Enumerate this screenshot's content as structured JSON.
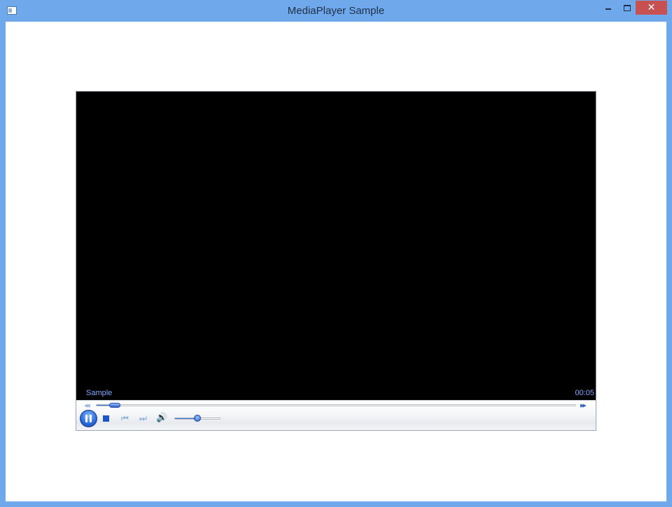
{
  "window": {
    "title": "MediaPlayer Sample",
    "close_glyph": "✕"
  },
  "player": {
    "media_title": "Sample",
    "elapsed_time": "00:05",
    "seek_progress": 0.03,
    "volume_level": 0.5,
    "colors": {
      "accent": "#2f6fe0",
      "label_text": "#7fa7ff",
      "close_button": "#c75050",
      "titlebar": "#6fa9ec"
    },
    "icons": {
      "rewind": "rewind-icon",
      "fast_forward": "fast-forward-icon",
      "pause": "pause-icon",
      "stop": "stop-icon",
      "previous": "skip-previous-icon",
      "next": "skip-next-icon",
      "volume": "volume-icon"
    },
    "glyphs": {
      "rewind": "◀◀",
      "fast_forward": "▶▶",
      "previous": "⏮",
      "next": "⏭",
      "volume": "🔊"
    }
  }
}
